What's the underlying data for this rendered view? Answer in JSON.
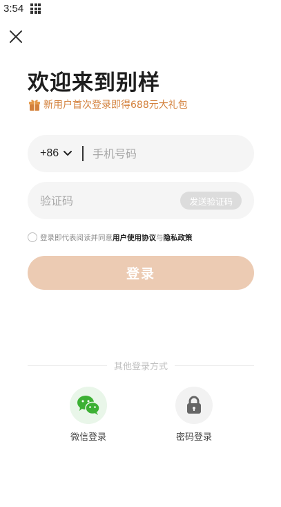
{
  "status_bar": {
    "time": "3:54"
  },
  "header": {
    "title": "欢迎来到别样",
    "promo_text": "新用户首次登录即得688元大礼包"
  },
  "phone": {
    "country_code": "+86",
    "placeholder": "手机号码"
  },
  "verification": {
    "placeholder": "验证码",
    "send_code_label": "发送验证码"
  },
  "agreement": {
    "prefix": "登录即代表阅读并同意",
    "user_agreement": "用户使用协议",
    "conjunction": "与",
    "privacy_policy": "隐私政策"
  },
  "login_button": {
    "label": "登录"
  },
  "other_methods": {
    "label": "其他登录方式",
    "wechat_label": "微信登录",
    "password_label": "密码登录"
  },
  "colors": {
    "accent": "#d3803b",
    "login_button": "#eccbb3",
    "wechat_green": "#3cb034"
  },
  "icons": {
    "close": "close-icon",
    "gift": "gift-icon",
    "chevron": "chevron-down-icon",
    "wechat": "wechat-icon",
    "lock": "lock-icon"
  }
}
